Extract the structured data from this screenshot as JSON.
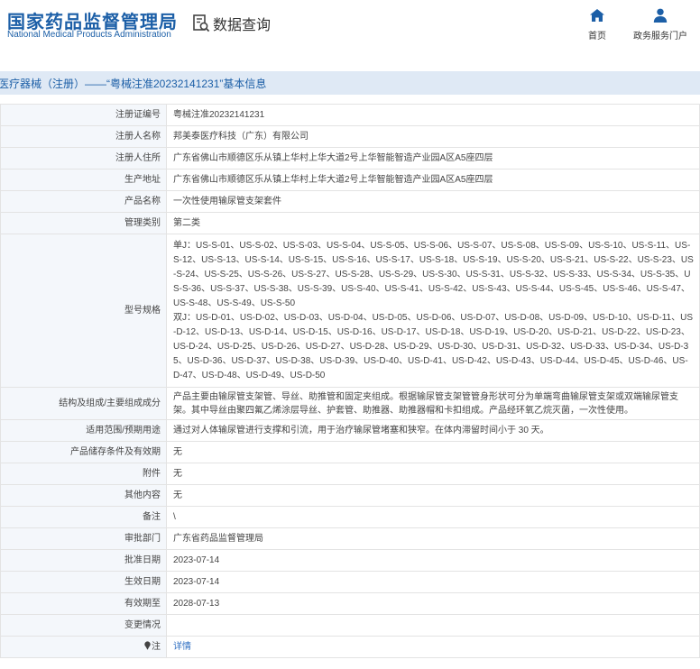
{
  "header": {
    "logo_cn": "国家药品监督管理局",
    "logo_en": "National Medical Products Administration",
    "query_icon": "search-document-icon",
    "query_label": "数据查询",
    "nav": [
      {
        "label": "首页",
        "icon": "home-icon"
      },
      {
        "label": "政务服务门户",
        "icon": "user-icon"
      }
    ],
    "brand_color": "#1c5fa7"
  },
  "title": "医疗器械（注册）——“粤械注准20232141231”基本信息",
  "rows": [
    {
      "label": "注册证编号",
      "value": "粤械注准20232141231"
    },
    {
      "label": "注册人名称",
      "value": "邦美泰医疗科技（广东）有限公司"
    },
    {
      "label": "注册人住所",
      "value": "广东省佛山市顺德区乐从镇上华村上华大道2号上华智能智造产业园A区A5座四层"
    },
    {
      "label": "生产地址",
      "value": "广东省佛山市顺德区乐从镇上华村上华大道2号上华智能智造产业园A区A5座四层"
    },
    {
      "label": "产品名称",
      "value": "一次性使用输尿管支架套件"
    },
    {
      "label": "管理类别",
      "value": "第二类"
    },
    {
      "label": "型号规格",
      "value": "单J：US-S-01、US-S-02、US-S-03、US-S-04、US-S-05、US-S-06、US-S-07、US-S-08、US-S-09、US-S-10、US-S-11、US-S-12、US-S-13、US-S-14、US-S-15、US-S-16、US-S-17、US-S-18、US-S-19、US-S-20、US-S-21、US-S-22、US-S-23、US-S-24、US-S-25、US-S-26、US-S-27、US-S-28、US-S-29、US-S-30、US-S-31、US-S-32、US-S-33、US-S-34、US-S-35、US-S-36、US-S-37、US-S-38、US-S-39、US-S-40、US-S-41、US-S-42、US-S-43、US-S-44、US-S-45、US-S-46、US-S-47、US-S-48、US-S-49、US-S-50",
      "value2": "双J：US-D-01、US-D-02、US-D-03、US-D-04、US-D-05、US-D-06、US-D-07、US-D-08、US-D-09、US-D-10、US-D-11、US-D-12、US-D-13、US-D-14、US-D-15、US-D-16、US-D-17、US-D-18、US-D-19、US-D-20、US-D-21、US-D-22、US-D-23、US-D-24、US-D-25、US-D-26、US-D-27、US-D-28、US-D-29、US-D-30、US-D-31、US-D-32、US-D-33、US-D-34、US-D-35、US-D-36、US-D-37、US-D-38、US-D-39、US-D-40、US-D-41、US-D-42、US-D-43、US-D-44、US-D-45、US-D-46、US-D-47、US-D-48、US-D-49、US-D-50"
    },
    {
      "label": "结构及组成/主要组成成分",
      "value": "产品主要由输尿管支架管、导丝、助推管和固定夹组成。根据输尿管支架管管身形状可分为单端弯曲输尿管支架或双端输尿管支架。其中导丝由聚四氟乙烯涂层导丝、护套管、助推器、助推器帽和卡扣组成。产品经环氧乙烷灭菌，一次性使用。"
    },
    {
      "label": "适用范围/预期用途",
      "value": "通过对人体输尿管进行支撑和引流，用于治疗输尿管堵塞和狭窄。在体内滞留时间小于 30 天。"
    },
    {
      "label": "产品储存条件及有效期",
      "value": "无"
    },
    {
      "label": "附件",
      "value": "无"
    },
    {
      "label": "其他内容",
      "value": "无"
    },
    {
      "label": "备注",
      "value": "\\"
    },
    {
      "label": "审批部门",
      "value": "广东省药品监督管理局"
    },
    {
      "label": "批准日期",
      "value": "2023-07-14"
    },
    {
      "label": "生效日期",
      "value": "2023-07-14"
    },
    {
      "label": "有效期至",
      "value": "2028-07-13"
    },
    {
      "label": "变更情况",
      "value": ""
    },
    {
      "label": "注",
      "label_icon": "pin-icon",
      "value": "详情"
    }
  ]
}
